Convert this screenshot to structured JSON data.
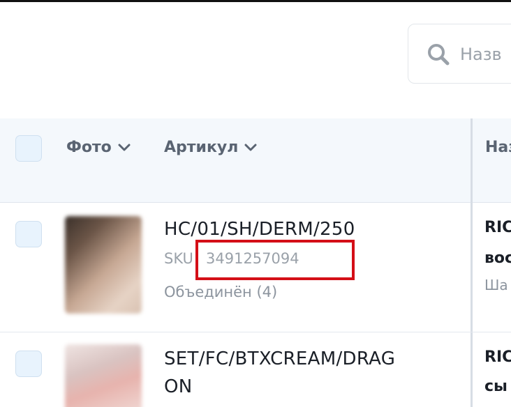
{
  "search": {
    "placeholder": "Назв"
  },
  "table": {
    "columns": [
      {
        "label": "Фото"
      },
      {
        "label": "Артикул"
      },
      {
        "label": "Наз"
      }
    ],
    "rows": [
      {
        "article": "HC/01/SH/DERM/250",
        "sku_prefix": "SKU",
        "sku_value": "3491257094",
        "merged": "Объединён (4)",
        "name_line1": "RIC",
        "name_line2": "вос",
        "name_line3": "Ша"
      },
      {
        "article_line1": "SET/FC/BTXCREAM/DRAG",
        "article_line2": "ON",
        "name_line1": "RIC",
        "name_line2": "сы"
      }
    ]
  },
  "colors": {
    "header_bg": "#f4f8fc",
    "checkbox_fill": "#e8f3fd",
    "highlight": "#d40f17"
  }
}
